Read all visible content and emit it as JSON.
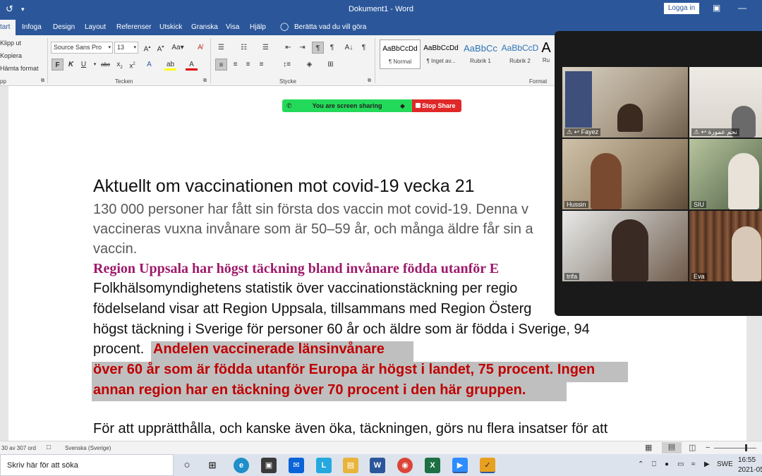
{
  "window": {
    "title": "Dokument1 - Word",
    "login": "Logga in"
  },
  "tabs": [
    "tart",
    "Infoga",
    "Design",
    "Layout",
    "Referenser",
    "Utskick",
    "Granska",
    "Visa",
    "Hjälp"
  ],
  "tell_me": "Berätta vad du vill göra",
  "clipboard": {
    "cut": "Klipp ut",
    "copy": "Kopiera",
    "format_painter": "Hämta format",
    "group": "pp"
  },
  "font": {
    "name": "Source Sans Pro",
    "size": "13",
    "group": "Tecken",
    "bold": "F",
    "italic": "K",
    "underline": "U",
    "strike": "abc"
  },
  "paragraph": {
    "group": "Stycke"
  },
  "styles": {
    "group": "Format",
    "items": [
      {
        "preview": "AaBbCcDd",
        "name": "¶ Normal"
      },
      {
        "preview": "AaBbCcDd",
        "name": "¶ Inget av..."
      },
      {
        "preview": "AaBbCc",
        "name": "Rubrik 1"
      },
      {
        "preview": "AaBbCcD",
        "name": "Rubrik 2"
      },
      {
        "preview": "A",
        "name": "Ru"
      }
    ]
  },
  "share": {
    "status": "You are screen sharing",
    "stop": "Stop Share"
  },
  "document": {
    "heading": "Aktuellt om vaccinationen mot covid-19 vecka 21",
    "intro": [
      "130 000 personer har fått sin första dos vaccin mot covid-19. Denna v",
      "vaccineras vuxna invånare som är 50–59 år, och många äldre får sin a",
      "vaccin."
    ],
    "subheading": "Region Uppsala har högst täckning bland invånare födda utanför E",
    "body": [
      "Folkhälsomyndighetens statistik över vaccinationstäckning per regio",
      "födelseland visar att Region Uppsala, tillsammans med Region Österg",
      "högst täckning i Sverige för personer 60 år och äldre som är födda i Sverige, 94",
      "procent. "
    ],
    "highlight": [
      "Andelen vaccinerade länsinvånare",
      "över 60 år som är födda utanför Europa är högst i landet, 75 procent. Ingen",
      "annan region har en täckning över 70 procent i den här gruppen."
    ],
    "next_paragraph": "För att upprätthålla, och kanske även öka, täckningen, görs nu flera insatser för att"
  },
  "statusbar": {
    "words": "30 av 307 ord",
    "language": "Svenska (Sverige)"
  },
  "taskbar": {
    "search": "Skriv här för att söka",
    "lang": "SWE",
    "time": "16:55",
    "date": "2021-05"
  },
  "participants": [
    {
      "name": "Fayez",
      "color": "#a89a86"
    },
    {
      "name": "نجم عمورة",
      "color": "#d8d4cc"
    },
    {
      "name": "Hussin",
      "color": "#9c8a70"
    },
    {
      "name": "SIU",
      "color": "#7a8a6a"
    },
    {
      "name": "trifa",
      "color": "#6e5a4a"
    },
    {
      "name": "Eva",
      "color": "#6a4a3a"
    }
  ],
  "colors": {
    "word_blue": "#2b579a",
    "share_green": "#23d959",
    "stop_red": "#e02828",
    "magenta_heading": "#9e1a6b",
    "highlight_red": "#c00000"
  }
}
